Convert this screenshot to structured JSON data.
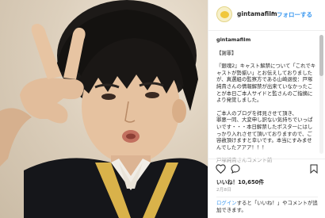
{
  "post": {
    "username": "gintamafilm",
    "follow_label": "フォローする",
    "separator": "•",
    "caption": {
      "heading": "【謝罪】",
      "paragraph1": "『銀魂2』キャスト解禁について「これでキャストが勢揃い」とお伝えしておりましたが、真選組の監察方である山崎退役：戸塚純貴さんの情報解禁が出来ていなかったことが本日ご本人サイドと監さんのご指摘により発覚しました。",
      "paragraph2": "ご本人のブログを拝見させて頂き、\n罪悪一同、大変申し訳ない気持ちでいっぱいです・・・本日解禁したポスターにはしっかり入れさせて頂いておりますので、ご容赦頂けますと幸いです。本当にすみませんでしたアアア！！！",
      "more_text": "戸塚純貴さんコメント前"
    },
    "likes_text": "いいね！10,650件",
    "date_text": "2月8日",
    "login_prompt": {
      "link_text": "ログイン",
      "rest_text": "すると「いいね！」やコメントが追加できます。"
    }
  },
  "icons": {
    "avatar": "gintama-logo-avatar",
    "like": "heart-icon",
    "comment": "comment-icon",
    "save": "bookmark-icon"
  },
  "colors": {
    "link": "#3897f0",
    "text": "#262626",
    "muted": "#999999",
    "photo_background": "#ddd0bd"
  }
}
